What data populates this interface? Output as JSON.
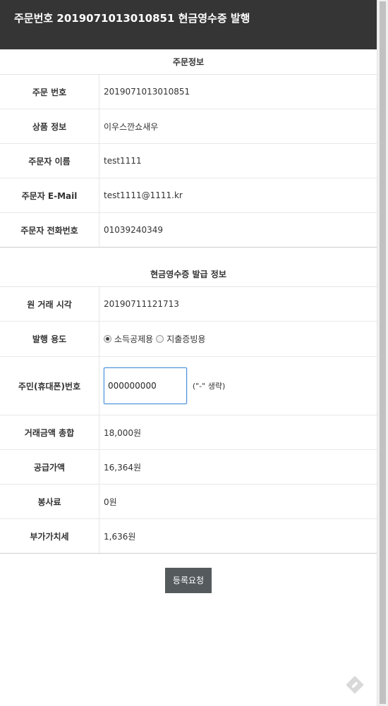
{
  "header": {
    "title": "주문번호 2019071013010851 현금영수증 발행"
  },
  "order_info": {
    "title": "주문정보",
    "rows": [
      {
        "label": "주문 번호",
        "value": "2019071013010851"
      },
      {
        "label": "상품 정보",
        "value": "이우스깐쇼새우"
      },
      {
        "label": "주문자 이름",
        "value": "test1111"
      },
      {
        "label": "주문자 E-Mail",
        "value": "test1111@1111.kr"
      },
      {
        "label": "주문자 전화번호",
        "value": "01039240349"
      }
    ]
  },
  "receipt_info": {
    "title": "현금영수증 발급 정보",
    "original_time": {
      "label": "원 거래 시각",
      "value": "20190711121713"
    },
    "purpose": {
      "label": "발행 용도",
      "options": [
        "소득공제용",
        "지출증빙용"
      ],
      "selected": "소득공제용"
    },
    "rrn": {
      "label": "주민(휴대폰)번호",
      "value": "000000000",
      "hint": "(\"-\" 생략)"
    },
    "amounts": [
      {
        "label": "거래금액 총합",
        "value": "18,000원"
      },
      {
        "label": "공급가액",
        "value": "16,364원"
      },
      {
        "label": "봉사료",
        "value": "0원"
      },
      {
        "label": "부가가치세",
        "value": "1,636원"
      }
    ]
  },
  "actions": {
    "submit_label": "등록요청"
  },
  "icons": {
    "floating": "edit-pencil-icon"
  },
  "colors": {
    "header_bg": "#353535",
    "button_bg": "#555a5d",
    "input_focus": "#4a90d9"
  }
}
